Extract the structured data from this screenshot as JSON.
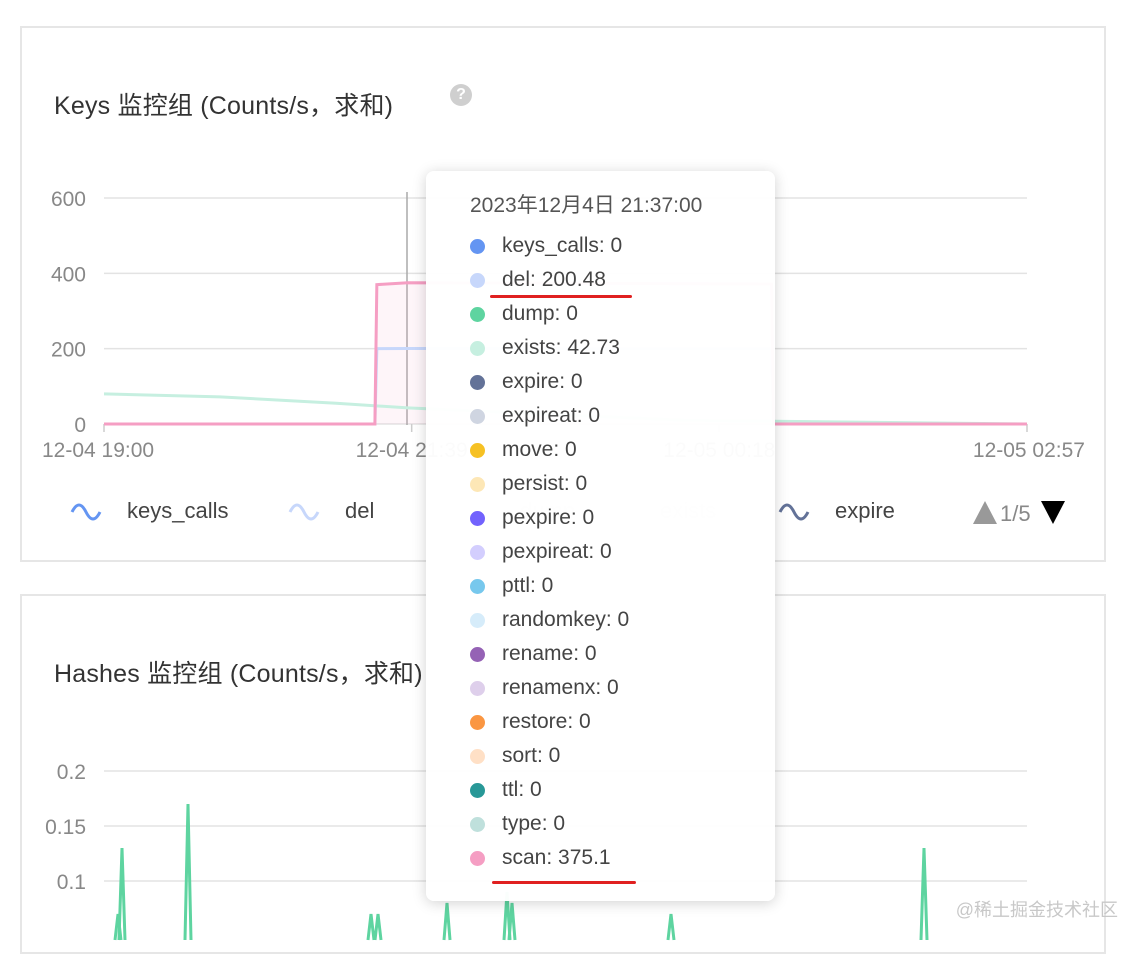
{
  "panels": [
    {
      "title": "Keys 监控组 (Counts/s，求和)",
      "help_icon": "question-circle-icon"
    },
    {
      "title": "Hashes 监控组 (Counts/s，求和)"
    }
  ],
  "chart_data": [
    {
      "type": "line",
      "title": "Keys 监控组 (Counts/s，求和)",
      "x_ticks": [
        "12-04 19:00",
        "12-04 21:39",
        "12-05 00:18",
        "12-05 02:57"
      ],
      "y_ticks": [
        0,
        200,
        400,
        600
      ],
      "ylim": [
        0,
        600
      ],
      "legend_placement": "bottom",
      "legend": [
        "keys_calls",
        "del",
        "dump",
        "exists",
        "expire"
      ],
      "legend_page": "1/5",
      "series": [
        {
          "name": "scan",
          "color": "#f59ec3",
          "x": [
            "12-04 19:00",
            "12-04 21:20",
            "12-04 21:21",
            "12-04 21:37",
            "12-05 00:45",
            "12-05 00:46",
            "12-05 02:57"
          ],
          "values": [
            0,
            0,
            370,
            375.1,
            372,
            0,
            0
          ]
        },
        {
          "name": "del",
          "color": "#c7d7fb",
          "x": [
            "12-04 19:00",
            "12-04 21:20",
            "12-04 21:21",
            "12-04 21:37",
            "12-05 00:45",
            "12-05 00:46",
            "12-05 02:57"
          ],
          "values": [
            0,
            0,
            200,
            200.48,
            200,
            0,
            0
          ]
        },
        {
          "name": "exists",
          "color": "#c6efe0",
          "x": [
            "12-04 19:00",
            "12-04 20:00",
            "12-04 21:00",
            "12-04 21:37",
            "12-05 00:00",
            "12-05 02:57"
          ],
          "values": [
            80,
            72,
            55,
            42.73,
            10,
            0
          ]
        }
      ]
    },
    {
      "type": "line",
      "title": "Hashes 监控组 (Counts/s，求和)",
      "y_ticks": [
        0.1,
        0.15,
        0.2
      ],
      "series": [
        {
          "name": "",
          "color": "#5ed4a0",
          "spikes": [
            0.07,
            0.13,
            0.17,
            0.07,
            0.07,
            0.08,
            0.09,
            0.08,
            0.07,
            0.13
          ]
        }
      ]
    }
  ],
  "tooltip": {
    "title": "2023年12月4日 21:37:00",
    "items": [
      {
        "label": "keys_calls: 0",
        "color": "#6495f2"
      },
      {
        "label": "del: 200.48",
        "color": "#c7d7fb"
      },
      {
        "label": "dump: 0",
        "color": "#5ed4a0"
      },
      {
        "label": "exists: 42.73",
        "color": "#c6efe0"
      },
      {
        "label": "expire: 0",
        "color": "#637298"
      },
      {
        "label": "expireat: 0",
        "color": "#cfd5e1"
      },
      {
        "label": "move: 0",
        "color": "#f6c124"
      },
      {
        "label": "persist: 0",
        "color": "#fde7b6"
      },
      {
        "label": "pexpire: 0",
        "color": "#7262fd"
      },
      {
        "label": "pexpireat: 0",
        "color": "#d3cefe"
      },
      {
        "label": "pttl: 0",
        "color": "#77c8ed"
      },
      {
        "label": "randomkey: 0",
        "color": "#d6ecfa"
      },
      {
        "label": "rename: 0",
        "color": "#9562b5"
      },
      {
        "label": "renamenx: 0",
        "color": "#decfeb"
      },
      {
        "label": "restore: 0",
        "color": "#fa9642"
      },
      {
        "label": "sort: 0",
        "color": "#ffe0c6"
      },
      {
        "label": "ttl: 0",
        "color": "#289897"
      },
      {
        "label": "type: 0",
        "color": "#bfe0dc"
      },
      {
        "label": "scan: 375.1",
        "color": "#f59ec3"
      }
    ]
  },
  "watermark": "@稀土掘金技术社区"
}
